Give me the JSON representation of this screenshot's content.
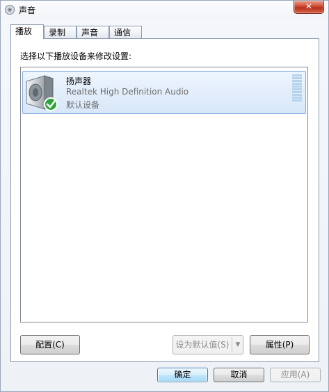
{
  "window": {
    "title": "声音",
    "close_label": "✕"
  },
  "tabs": [
    {
      "label": "播放",
      "active": true
    },
    {
      "label": "录制",
      "active": false
    },
    {
      "label": "声音",
      "active": false
    },
    {
      "label": "通信",
      "active": false
    }
  ],
  "panel": {
    "instruction": "选择以下播放设备来修改设置:",
    "devices": [
      {
        "name": "扬声器",
        "driver": "Realtek High Definition Audio",
        "status": "默认设备",
        "icon": "speaker-icon",
        "default_badge": "check-icon"
      }
    ],
    "buttons": {
      "configure": "配置(C)",
      "set_default": "设为默认值(S)",
      "properties": "属性(P)"
    }
  },
  "footer": {
    "ok": "确定",
    "cancel": "取消",
    "apply": "应用(A)"
  }
}
